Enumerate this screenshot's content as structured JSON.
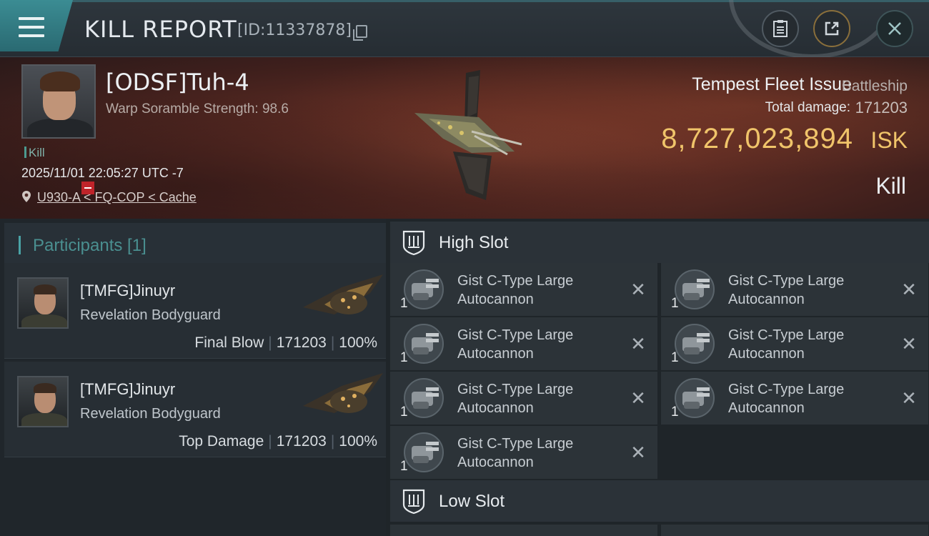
{
  "header": {
    "title": "KILL REPORT",
    "report_id": "[ID:11337878]"
  },
  "victim": {
    "pilot": "[ODSF]Tuh-4",
    "scramble": "Warp Soramble Strength: 98.6",
    "tag": "Kill",
    "datetime": "2025/11/01 22:05:27 UTC -7",
    "location": "U930-A < FQ-COP < Cache",
    "ship_name": "Tempest Fleet Issue",
    "ship_class": "Battleship",
    "damage_label": "Total damage:",
    "damage_value": "171203",
    "isk_value": "8,727,023,894",
    "isk_unit": "ISK",
    "result": "Kill"
  },
  "participants": {
    "title": "Participants [1]",
    "rows": [
      {
        "name": "[TMFG]Jinuyr",
        "ship": "Revelation Bodyguard",
        "role": "Final Blow",
        "damage": "171203",
        "percent": "100%"
      },
      {
        "name": "[TMFG]Jinuyr",
        "ship": "Revelation Bodyguard",
        "role": "Top Damage",
        "damage": "171203",
        "percent": "100%"
      }
    ]
  },
  "slots": {
    "high": {
      "label": "High Slot",
      "modules": [
        {
          "name": "Gist C-Type Large Autocannon",
          "qty": "1"
        },
        {
          "name": "Gist C-Type Large Autocannon",
          "qty": "1"
        },
        {
          "name": "Gist C-Type Large Autocannon",
          "qty": "1"
        },
        {
          "name": "Gist C-Type Large Autocannon",
          "qty": "1"
        },
        {
          "name": "Gist C-Type Large Autocannon",
          "qty": "1"
        },
        {
          "name": "Gist C-Type Large Autocannon",
          "qty": "1"
        },
        {
          "name": "Gist C-Type Large Autocannon",
          "qty": "1"
        }
      ]
    },
    "low": {
      "label": "Low Slot"
    }
  },
  "colors": {
    "accent": "#3b8c93",
    "isk": "#f0c46a",
    "negative_badge": "#c0242a"
  }
}
